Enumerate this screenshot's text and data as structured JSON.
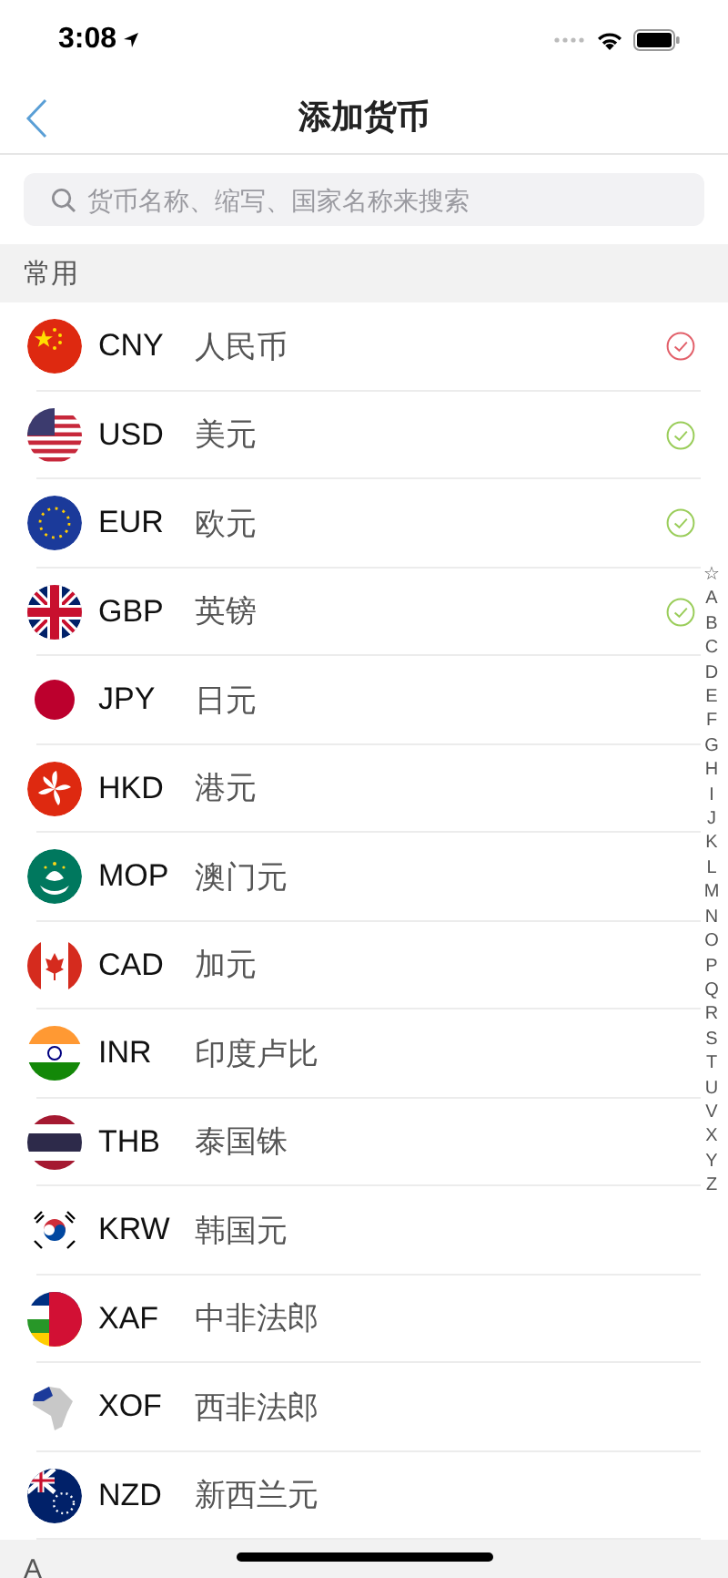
{
  "status_bar": {
    "time": "3:08"
  },
  "nav": {
    "title": "添加货币"
  },
  "search": {
    "placeholder": "货币名称、缩写、国家名称来搜索"
  },
  "sections": [
    {
      "header": "常用",
      "rows": [
        {
          "code": "CNY",
          "name": "人民币",
          "checked": true,
          "color": "#e2606a"
        },
        {
          "code": "USD",
          "name": "美元",
          "checked": true,
          "color": "#9acd5a"
        },
        {
          "code": "EUR",
          "name": "欧元",
          "checked": true,
          "color": "#9acd5a"
        },
        {
          "code": "GBP",
          "name": "英镑",
          "checked": true,
          "color": "#9acd5a"
        },
        {
          "code": "JPY",
          "name": "日元",
          "checked": false
        },
        {
          "code": "HKD",
          "name": "港元",
          "checked": false
        },
        {
          "code": "MOP",
          "name": "澳门元",
          "checked": false
        },
        {
          "code": "CAD",
          "name": "加元",
          "checked": false
        },
        {
          "code": "INR",
          "name": "印度卢比",
          "checked": false
        },
        {
          "code": "THB",
          "name": "泰国铢",
          "checked": false
        },
        {
          "code": "KRW",
          "name": "韩国元",
          "checked": false
        },
        {
          "code": "XAF",
          "name": "中非法郎",
          "checked": false
        },
        {
          "code": "XOF",
          "name": "西非法郎",
          "checked": false
        },
        {
          "code": "NZD",
          "name": "新西兰元",
          "checked": false
        }
      ]
    },
    {
      "header": "A"
    }
  ],
  "index": [
    "☆",
    "A",
    "B",
    "C",
    "D",
    "E",
    "F",
    "G",
    "H",
    "I",
    "J",
    "K",
    "L",
    "M",
    "N",
    "O",
    "P",
    "Q",
    "R",
    "S",
    "T",
    "U",
    "V",
    "X",
    "Y",
    "Z"
  ]
}
